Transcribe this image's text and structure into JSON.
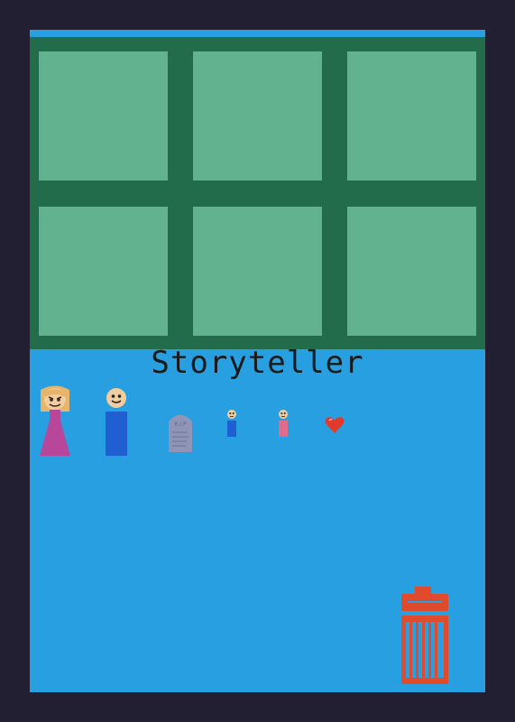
{
  "title": "Storyteller",
  "colors": {
    "background": "#221f33",
    "stage": "#279fe0",
    "board": "#226b4b",
    "panel": "#62b18f",
    "trash": "#e04a2d"
  },
  "board": {
    "rows": 2,
    "columns": 3,
    "panel_count": 6
  },
  "pieces": [
    {
      "name": "princess-figure",
      "icon": "woman-in-pink-dress"
    },
    {
      "name": "man-figure",
      "icon": "man-in-blue"
    },
    {
      "name": "tombstone",
      "icon": "tombstone",
      "text": "R.I.P"
    },
    {
      "name": "small-boy-figure",
      "icon": "small-blue-figure"
    },
    {
      "name": "small-girl-figure",
      "icon": "small-pink-figure"
    },
    {
      "name": "heart",
      "icon": "red-heart"
    }
  ],
  "trash": {
    "icon": "trash-can-icon"
  }
}
